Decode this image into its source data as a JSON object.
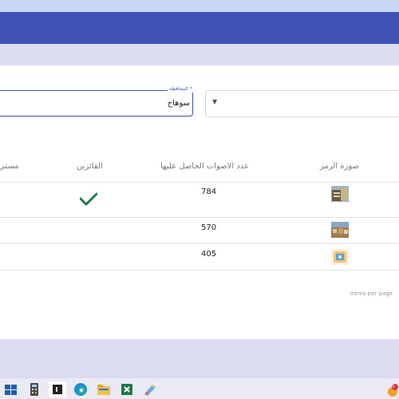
{
  "filter": {
    "governorate_label": "المحافظة *",
    "governorate_value": "سوهاج",
    "second_select_value": ""
  },
  "table": {
    "headers": {
      "image": "صورة الرمز",
      "votes": "عدد الاصوات الحاصل عليها",
      "winners": "الفائزين",
      "level_partial": "مستي"
    },
    "rows": [
      {
        "votes": "784",
        "winner": true
      },
      {
        "votes": "570",
        "winner": false
      },
      {
        "votes": "405",
        "winner": false
      }
    ]
  },
  "paginator": {
    "items_per_page_label": "Items per page"
  },
  "taskbar": {
    "notification_count": "1"
  }
}
